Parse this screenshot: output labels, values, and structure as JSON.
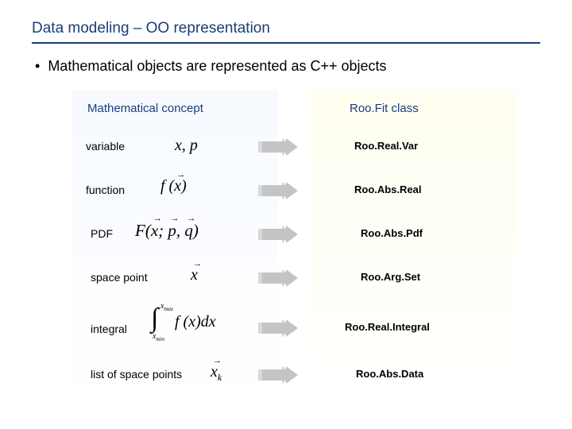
{
  "title": "Data modeling – OO representation",
  "bullet": "Mathematical objects are represented as C++ objects",
  "headers": {
    "left": "Mathematical concept",
    "right": "Roo.Fit class"
  },
  "rows": {
    "variable": {
      "label": "variable",
      "math": "x, p",
      "class": "Roo.Real.Var"
    },
    "function": {
      "label": "function",
      "math": "f(x)",
      "class": "Roo.Abs.Real"
    },
    "pdf": {
      "label": "PDF",
      "math": "F(x; p, q)",
      "class": "Roo.Abs.Pdf"
    },
    "spacepoint": {
      "label": "space point",
      "math": "x",
      "class": "Roo.Arg.Set"
    },
    "integral": {
      "label": "integral",
      "math": "∫ f(x) dx",
      "class": "Roo.Real.Integral",
      "lower": "x_min",
      "upper": "x_max"
    },
    "listpoints": {
      "label": "list of space points",
      "math": "x_k",
      "class": "Roo.Abs.Data"
    }
  }
}
